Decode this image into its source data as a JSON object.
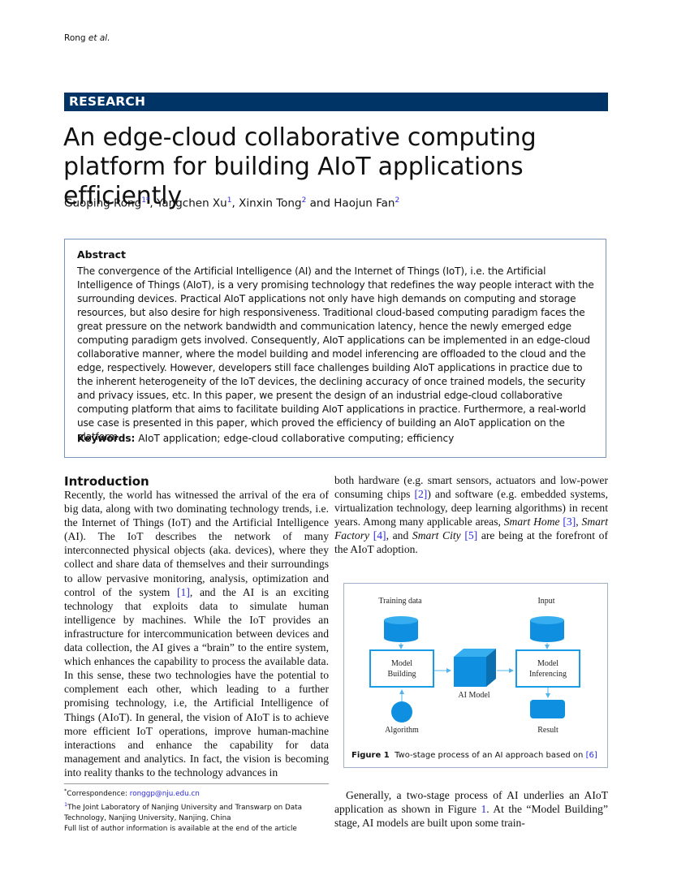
{
  "running_head": {
    "author": "Rong",
    "etal": "et al."
  },
  "section_tag": "RESEARCH",
  "title": "An edge-cloud collaborative computing platform for building AIoT applications efficiently",
  "authors": [
    {
      "name": "Guoping Rong",
      "aff": "1*"
    },
    {
      "name": "Yangchen Xu",
      "aff": "1"
    },
    {
      "name": "Xinxin Tong",
      "aff": "2"
    },
    {
      "name": "Haojun Fan",
      "aff": "2"
    }
  ],
  "author_separators": [
    ", ",
    ", ",
    " and "
  ],
  "abstract": {
    "heading": "Abstract",
    "text": "The convergence of the Artificial Intelligence (AI) and the Internet of Things (IoT), i.e. the Artificial Intelligence of Things (AIoT), is a very promising technology that redefines the way people interact with the surrounding devices. Practical AIoT applications not only have high demands on computing and storage resources, but also desire for high responsiveness. Traditional cloud-based computing paradigm faces the great pressure on the network bandwidth and communication latency, hence the newly emerged edge computing paradigm gets involved. Consequently, AIoT applications can be implemented in an edge-cloud collaborative manner, where the model building and model inferencing are offloaded to the cloud and the edge, respectively. However, developers still face challenges building AIoT applications in practice due to the inherent heterogeneity of the IoT devices, the declining accuracy of once trained models, the security and privacy issues, etc. In this paper, we present the design of an industrial edge-cloud collaborative computing platform that aims to facilitate building AIoT applications in practice. Furthermore, a real-world use case is presented in this paper, which proved the efficiency of building an AIoT application on the platform.",
    "keywords_label": "Keywords:",
    "keywords": "AIoT application; edge-cloud collaborative computing; efficiency"
  },
  "introduction": {
    "heading": "Introduction",
    "left_p1_a": "Recently, the world has witnessed the arrival of the era of big data, along with two dominating technology trends, i.e. the Internet of Things (IoT) and the Artificial Intelligence (AI). The IoT describes the network of many interconnected physical objects (aka. devices), where they collect and share data of themselves and their surroundings to allow pervasive monitoring, analysis, optimization and control of the system ",
    "ref1": "[1]",
    "left_p1_b": ", and the AI is an exciting technology that exploits data to simulate human intelligence by machines. While the IoT provides an infrastructure for intercommunication between devices and data collection, the AI gives a “brain” to the entire system, which enhances the capability to process the available data. In this sense, these two technologies have the potential to complement each other, which leading to a further promising technology, i.e, the Artificial Intelligence of Things (AIoT). In general, the vision of AIoT is to achieve more efficient IoT operations, improve human-machine interactions and enhance the capability for data management and analytics. In fact, the vision is becoming into reality thanks to the technology advances in",
    "right_a": "both hardware (e.g. smart sensors, actuators and low-power consuming chips ",
    "ref2": "[2]",
    "right_b": ") and software (e.g. embedded systems, virtualization technology, deep learning algorithms) in recent years. Among many applicable areas, ",
    "smart_home": "Smart Home",
    "ref3": "[3]",
    "sep1": ", ",
    "smart_factory": "Smart Factory",
    "ref4": "[4]",
    "sep2": ", and ",
    "smart_city": "Smart City",
    "ref5": "[5]",
    "right_c": " are being at the forefront of the AIoT adoption.",
    "p2_a": "Generally, a two-stage process of AI underlies an AIoT application as shown in Figure ",
    "fig_ref": "1",
    "p2_b": ". At the “Model Building” stage, AI models are built upon some train-"
  },
  "footnotes": {
    "corr_mark": "*",
    "corr_label": "Correspondence: ",
    "email": "ronggp@nju.edu.cn",
    "aff1_mark": "1",
    "aff1": "The Joint Laboratory of Nanjing University and Transwarp on Data Technology, Nanjing University, Nanjing, China",
    "more": "Full list of author information is available at the end of the article"
  },
  "figure": {
    "labels": {
      "training_data": "Training data",
      "input": "Input",
      "model_building_1": "Model",
      "model_building_2": "Building",
      "model_inferencing_1": "Model",
      "model_inferencing_2": "Inferencing",
      "ai_model": "AI Model",
      "algorithm": "Algorithm",
      "result": "Result"
    },
    "caption_label": "Figure 1",
    "caption_text": "Two-stage process of an AI approach based on ",
    "caption_ref": "[6]",
    "colors": {
      "fill": "#0f8fdf",
      "fill_light": "#36aef0",
      "fill_dark": "#0b6fb0",
      "stroke": "#1a9be6",
      "arrow": "#53b4ec"
    }
  }
}
